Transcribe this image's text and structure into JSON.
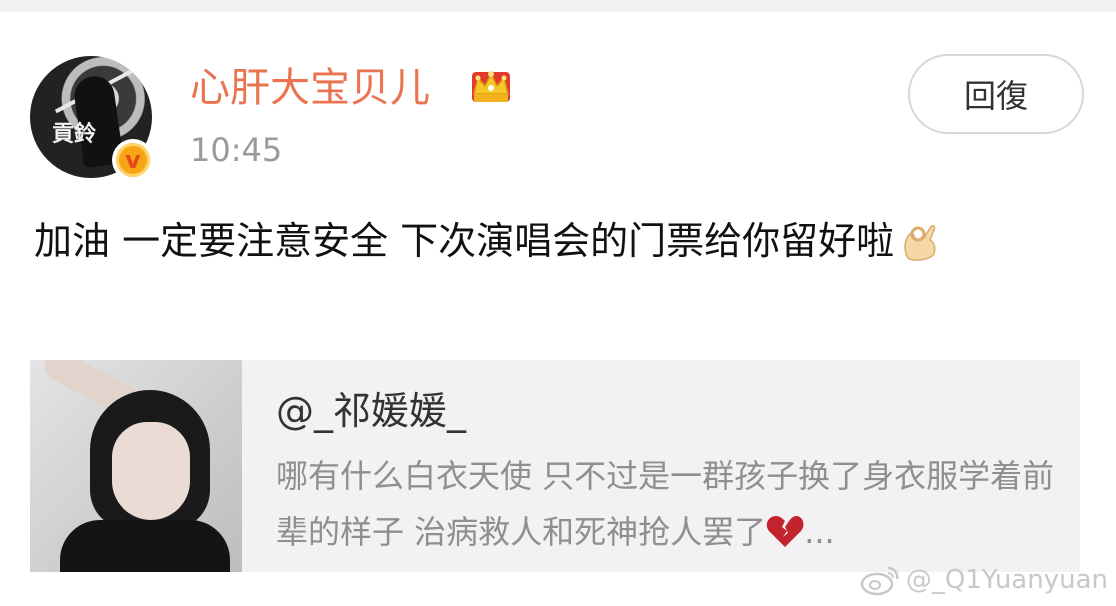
{
  "post": {
    "username": "心肝大宝贝儿",
    "time": "10:45",
    "reply_label": "回復",
    "comment": "加油 一定要注意安全 下次演唱会的门票给你留好啦",
    "avatar_caption": "貢鈴"
  },
  "quote": {
    "handle": "@_祁媛媛_",
    "text": "哪有什么白衣天使 只不过是一群孩子换了身衣服学着前辈的样子 治病救人和死神抢人罢了",
    "ellipsis": "..."
  },
  "watermark": {
    "text": "@_Q1Yuanyuan"
  },
  "icons": {
    "crown": "crown-icon",
    "verify": "verified-badge-icon",
    "ok_hand": "ok-hand-icon",
    "broken_heart": "broken-heart-icon",
    "weibo": "weibo-logo-icon"
  },
  "colors": {
    "username": "#eb7350",
    "timestamp": "#9a9a9a",
    "quote_bg": "#f2f2f2",
    "quote_text": "#8f8f8f",
    "verify": "#f6a516"
  }
}
